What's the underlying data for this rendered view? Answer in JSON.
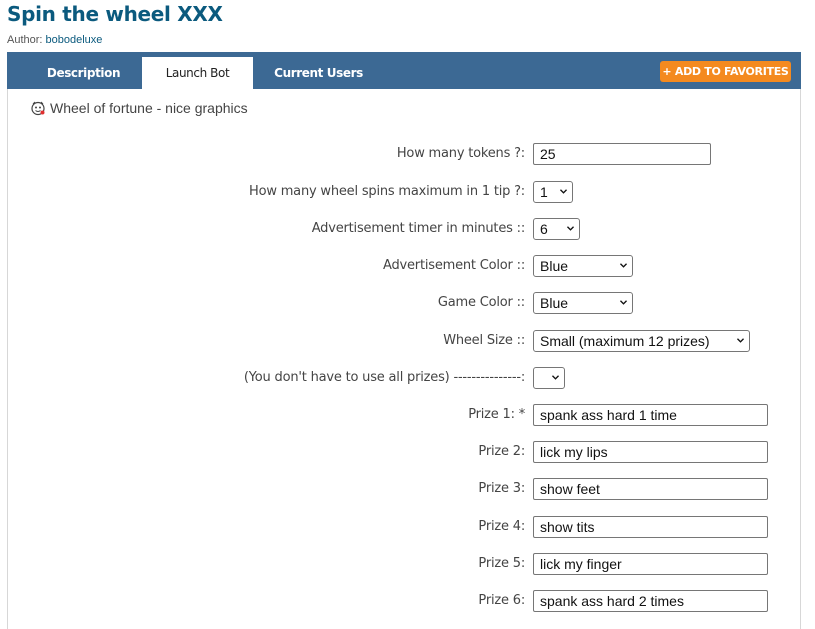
{
  "page": {
    "title": "Spin the wheel XXX",
    "author_label": "Author:",
    "author_name": "bobodeluxe"
  },
  "tabs": [
    {
      "label": "Description",
      "active": false
    },
    {
      "label": "Launch Bot",
      "active": true
    },
    {
      "label": "Current Users",
      "active": false
    }
  ],
  "favorites_button": "+ ADD TO FAVORITES",
  "bot_description": "Wheel of fortune - nice graphics",
  "form": {
    "tokens": {
      "label": "How many tokens ?:",
      "value": "25"
    },
    "max_spins": {
      "label": "How many wheel spins maximum in 1 tip ?:",
      "value": "1"
    },
    "ad_timer": {
      "label": "Advertisement timer in minutes ::",
      "value": "6"
    },
    "ad_color": {
      "label": "Advertisement Color ::",
      "value": "Blue"
    },
    "game_color": {
      "label": "Game Color ::",
      "value": "Blue"
    },
    "wheel_size": {
      "label": "Wheel Size ::",
      "value": "Small (maximum 12 prizes)"
    },
    "all_prizes": {
      "label": "(You don't have to use all prizes) ---------------:",
      "value": ""
    },
    "prizes": [
      {
        "label": "Prize 1: *",
        "value": "spank ass hard 1 time"
      },
      {
        "label": "Prize 2:",
        "value": "lick my lips"
      },
      {
        "label": "Prize 3:",
        "value": "show feet"
      },
      {
        "label": "Prize 4:",
        "value": "show tits"
      },
      {
        "label": "Prize 5:",
        "value": "lick my finger"
      },
      {
        "label": "Prize 6:",
        "value": "spank ass hard 2 times"
      }
    ]
  },
  "colors": {
    "title": "#0b5a7e",
    "tabbar": "#3c6994",
    "favorites": "#f48a1f"
  }
}
